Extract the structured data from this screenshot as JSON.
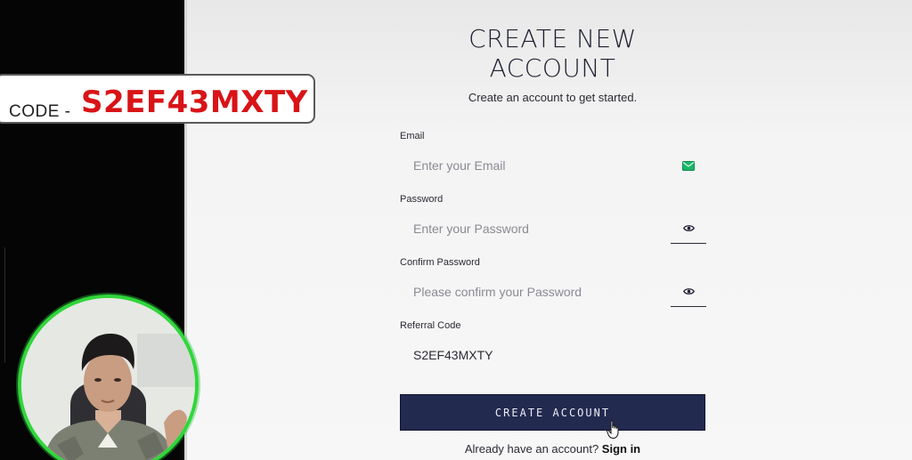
{
  "form": {
    "title_line1": "CREATE NEW",
    "title_line2": "ACCOUNT",
    "subtitle": "Create an account to get started.",
    "email": {
      "label": "Email",
      "placeholder": "Enter your Email",
      "icon": "envelope-icon"
    },
    "password": {
      "label": "Password",
      "placeholder": "Enter your Password",
      "icon": "eye-icon"
    },
    "confirm_password": {
      "label": "Confirm Password",
      "placeholder": "Please confirm your Password",
      "icon": "eye-icon"
    },
    "referral": {
      "label": "Referral Code",
      "value": "S2EF43MXTY"
    },
    "submit_label": "CREATE ACCOUNT",
    "signin_prompt": "Already have an account?",
    "signin_link": "Sign in"
  },
  "overlay": {
    "code_label": "CODE -",
    "code_value": "S2EF43MXTY"
  },
  "colors": {
    "button_bg": "#232a4f",
    "code_red": "#d81417",
    "webcam_ring": "#31d63a",
    "email_icon_green": "#1bb56a"
  }
}
